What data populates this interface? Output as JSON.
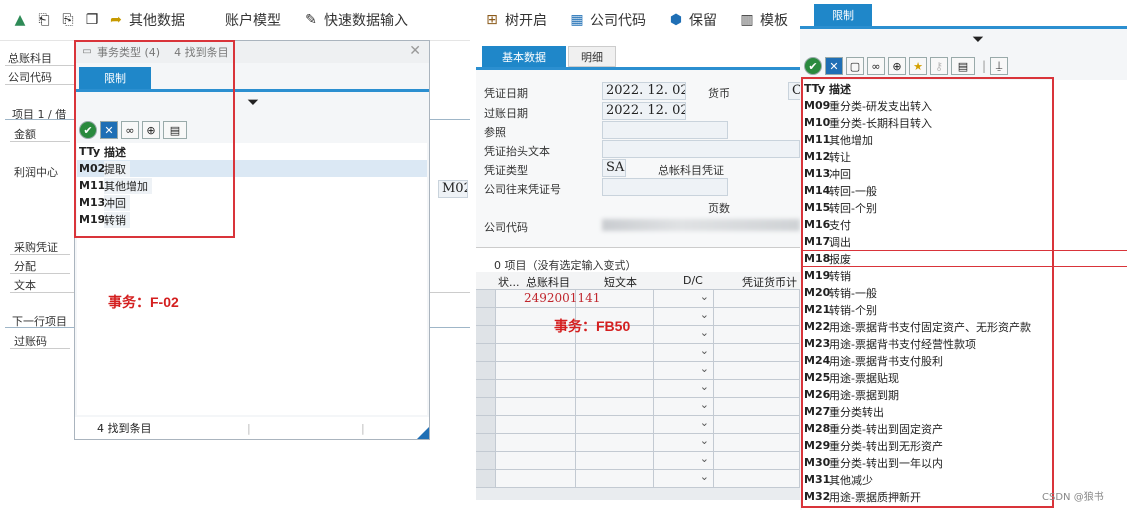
{
  "left": {
    "toolbar": {
      "other_data": "其他数据",
      "account_model": "账户模型",
      "fast_entry": "快速数据输入"
    },
    "fields": {
      "gl_account": "总账科目",
      "company_code": "公司代码",
      "item_label": "项目 1 / 借",
      "amount": "金额",
      "profit_center": "利润中心",
      "purchase_doc": "采购凭证",
      "assignment": "分配",
      "text": "文本",
      "next_item": "下一行项目",
      "posting_key": "过账码",
      "m02_value": "M02"
    },
    "popup": {
      "title": "事务类型 (4)",
      "found": "4 找到条目",
      "tab": "限制",
      "headers": {
        "code": "TTy",
        "desc": "描述"
      },
      "rows": [
        {
          "code": "M02",
          "desc": "提取"
        },
        {
          "code": "M11",
          "desc": "其他增加"
        },
        {
          "code": "M13",
          "desc": "冲回"
        },
        {
          "code": "M19",
          "desc": "转销"
        }
      ],
      "footer": "4 找到条目"
    },
    "annotation": "事务：F-02"
  },
  "middle": {
    "toolbar": {
      "tree_open": "树开启",
      "company_code": "公司代码",
      "save": "保留",
      "template": "模板"
    },
    "tabs": {
      "basic": "基本数据",
      "detail": "明细"
    },
    "fields": {
      "doc_date": "凭证日期",
      "doc_date_value": "2022. 12. 02",
      "currency": "货币",
      "currency_value": "C",
      "post_date": "过账日期",
      "post_date_value": "2022. 12. 02",
      "reference": "参照",
      "header_text": "凭证抬头文本",
      "doc_type": "凭证类型",
      "doc_type_value": "SA",
      "doc_type_desc": "总帐科目凭证",
      "intercompany": "公司往来凭证号",
      "page": "页数",
      "company_code": "公司代码"
    },
    "items_status": "0 项目（没有选定输入变式）",
    "grid": {
      "headers": [
        "状...",
        "总账科目",
        "短文本",
        "D/C",
        "凭证货币计"
      ],
      "first_account": "2492001141"
    },
    "annotation": "事务：FB50"
  },
  "right": {
    "tab": "限制",
    "headers": {
      "code": "TTy",
      "desc": "描述"
    },
    "rows": [
      {
        "code": "M09",
        "desc": "重分类-研发支出转入"
      },
      {
        "code": "M10",
        "desc": "重分类-长期科目转入"
      },
      {
        "code": "M11",
        "desc": "其他增加"
      },
      {
        "code": "M12",
        "desc": "转让"
      },
      {
        "code": "M13",
        "desc": "冲回"
      },
      {
        "code": "M14",
        "desc": "转回-一般"
      },
      {
        "code": "M15",
        "desc": "转回-个别"
      },
      {
        "code": "M16",
        "desc": "支付"
      },
      {
        "code": "M17",
        "desc": "调出"
      },
      {
        "code": "M18",
        "desc": "报废"
      },
      {
        "code": "M19",
        "desc": "转销"
      },
      {
        "code": "M20",
        "desc": "转销-一般"
      },
      {
        "code": "M21",
        "desc": "转销-个别"
      },
      {
        "code": "M22",
        "desc": "用途-票据背书支付固定资产、无形资产款"
      },
      {
        "code": "M23",
        "desc": "用途-票据背书支付经营性款项"
      },
      {
        "code": "M24",
        "desc": "用途-票据背书支付股利"
      },
      {
        "code": "M25",
        "desc": "用途-票据贴现"
      },
      {
        "code": "M26",
        "desc": "用途-票据到期"
      },
      {
        "code": "M27",
        "desc": "重分类转出"
      },
      {
        "code": "M28",
        "desc": "重分类-转出到固定资产"
      },
      {
        "code": "M29",
        "desc": "重分类-转出到无形资产"
      },
      {
        "code": "M30",
        "desc": "重分类-转出到一年以内"
      },
      {
        "code": "M31",
        "desc": "其他减少"
      },
      {
        "code": "M32",
        "desc": "用途-票据质押新开"
      }
    ]
  },
  "watermark": "CSDN @狼书"
}
